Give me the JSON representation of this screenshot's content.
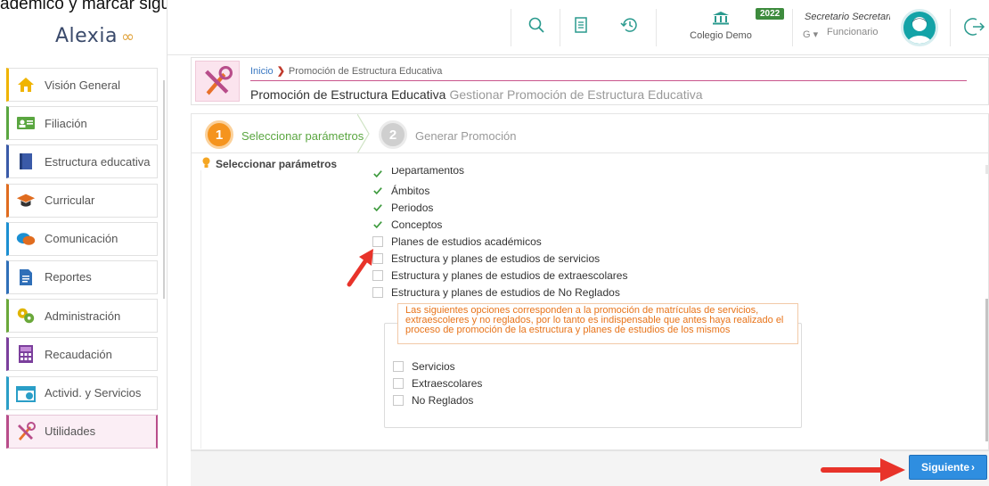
{
  "caption": "adémico y marcar siguiente.",
  "app": {
    "logo": "Alexia"
  },
  "sidebar": {
    "items": [
      {
        "label": "Visión General",
        "icon": "home-icon",
        "color": "#f0b400"
      },
      {
        "label": "Filiación",
        "icon": "id-card-icon",
        "color": "#5aa640"
      },
      {
        "label": "Estructura educativa",
        "icon": "book-icon",
        "color": "#3a5aa8"
      },
      {
        "label": "Curricular",
        "icon": "graduation-cap-icon",
        "color": "#e06c1f"
      },
      {
        "label": "Comunicación",
        "icon": "chat-bubbles-icon",
        "color": "#1b8fd2"
      },
      {
        "label": "Reportes",
        "icon": "report-icon",
        "color": "#2f6fb8"
      },
      {
        "label": "Administración",
        "icon": "gears-icon",
        "color": "#6aa83a"
      },
      {
        "label": "Recaudación",
        "icon": "cash-register-icon",
        "color": "#7b3f9c"
      },
      {
        "label": "Activid. y Servicios",
        "icon": "calendar-icon",
        "color": "#2a9ec7"
      },
      {
        "label": "Utilidades",
        "icon": "tools-icon",
        "color": "#b84d8a"
      }
    ]
  },
  "topbar": {
    "school": "Colegio Demo",
    "year": "2022",
    "user_name": "Secretario Secretari...",
    "user_role": "Funcionario",
    "user_g": "G"
  },
  "header": {
    "breadcrumb_home": "Inicio",
    "breadcrumb_current": "Promoción de Estructura Educativa",
    "title": "Promoción de Estructura Educativa",
    "subtitle": "Gestionar Promoción de Estructura Educativa"
  },
  "steps": [
    {
      "number": "1",
      "label": "Seleccionar parámetros",
      "active": true
    },
    {
      "number": "2",
      "label": "Generar Promoción",
      "active": false
    }
  ],
  "panel": {
    "title": "Seleccionar parámetros",
    "options": [
      {
        "label": "Departamentos",
        "checked": true
      },
      {
        "label": "Ámbitos",
        "checked": true
      },
      {
        "label": "Periodos",
        "checked": true
      },
      {
        "label": "Conceptos",
        "checked": true
      },
      {
        "label": "Planes de estudios académicos",
        "checked": false
      },
      {
        "label": "Estructura y planes de estudios de servicios",
        "checked": false
      },
      {
        "label": "Estructura y planes de estudios de extraescolares",
        "checked": false
      },
      {
        "label": "Estructura y planes de estudios de No Reglados",
        "checked": false
      }
    ],
    "notice": "Las siguientes opciones corresponden a la promoción de matrículas de servicios, extraescoleres y no reglados, por lo tanto es indispensable que antes haya realizado el proceso de promoción de la estructura y planes de estudios de los mismos",
    "sub_options": [
      {
        "label": "Servicios",
        "checked": false
      },
      {
        "label": "Extraescolares",
        "checked": false
      },
      {
        "label": "No Reglados",
        "checked": false
      }
    ]
  },
  "footer": {
    "next_label": "Siguiente"
  },
  "colors": {
    "accent": "#b84d8a",
    "step_active": "#f5941e",
    "primary_button": "#2f8ee0",
    "check": "#3d9a3d",
    "notice": "#e8741a",
    "annotation_arrow": "#e8332a"
  }
}
